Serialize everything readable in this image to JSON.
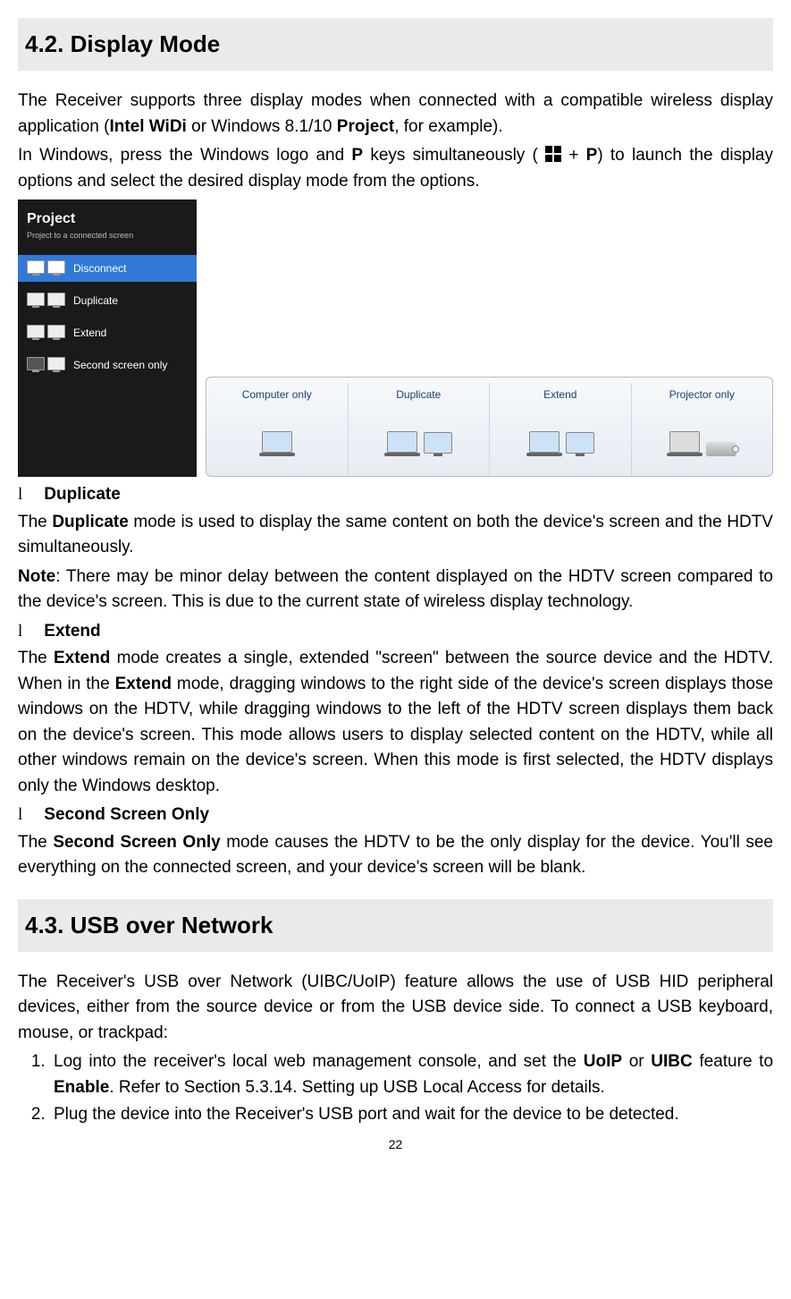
{
  "sections": {
    "displayMode": {
      "heading": "4.2.   Display Mode"
    },
    "usbOverNetwork": {
      "heading": "4.3.   USB over Network"
    }
  },
  "intro": {
    "p1_a": "The Receiver supports three display modes when connected with a compatible wireless display application (",
    "p1_b_bold": "Intel WiDi",
    "p1_c": " or Windows 8.1/10 ",
    "p1_d_bold": "Project",
    "p1_e": ", for example).",
    "p2_a": "In Windows, press the Windows logo and ",
    "p2_b_bold": "P",
    "p2_c": " keys simultaneously ( ",
    "p2_d": " + ",
    "p2_e_bold": "P",
    "p2_f": ") to launch the display options and select the desired display mode from the options."
  },
  "projectPanel": {
    "title": "Project",
    "subtitle": "Project to a connected screen",
    "options": [
      "Disconnect",
      "Duplicate",
      "Extend",
      "Second screen only"
    ]
  },
  "win7Panel": {
    "options": [
      "Computer only",
      "Duplicate",
      "Extend",
      "Projector only"
    ]
  },
  "bullets": {
    "duplicate": "Duplicate",
    "extend": "Extend",
    "second": "Second Screen Only"
  },
  "duplicate": {
    "p1_a": "The ",
    "p1_b_bold": "Duplicate",
    "p1_c": " mode is used to display the same content on both the device's screen and the HDTV simultaneously.",
    "note_label": "Note",
    "note_text": ": There may be minor delay between the content displayed on the HDTV screen compared to the device's screen. This is due to the current state of wireless display technology."
  },
  "extend": {
    "p1_a": "The ",
    "p1_b_bold": "Extend",
    "p1_c": " mode creates a single, extended \"screen\" between the source device and the HDTV. When in the ",
    "p1_d_bold": "Extend",
    "p1_e": " mode, dragging windows to the right side of the device's screen displays those windows on the HDTV, while dragging windows to the left of the HDTV screen displays them back on the device's screen. This mode allows users to display selected content on the HDTV, while all other windows remain on the device's screen. When this mode is first selected, the HDTV displays only the Windows desktop."
  },
  "second": {
    "p1_a": "The ",
    "p1_b_bold": "Second Screen Only",
    "p1_c": " mode causes the HDTV to be the only display for the device. You'll see everything on the connected screen, and your device's screen will be blank."
  },
  "usb": {
    "intro": "The Receiver's USB over Network (UIBC/UoIP) feature allows the use of USB HID peripheral devices, either from the source device or from the USB device side. To connect a USB keyboard, mouse, or trackpad:",
    "step1_a": "Log into the receiver's local web management console, and set the ",
    "step1_b_bold": "UoIP",
    "step1_c": " or ",
    "step1_d_bold": "UIBC",
    "step1_e": " feature to ",
    "step1_f_bold": "Enable",
    "step1_g": ". Refer to Section 5.3.14. Setting up USB Local Access for details.",
    "step2": "Plug the device into the Receiver's USB port and wait for the device to be detected."
  },
  "pageNumber": "22"
}
